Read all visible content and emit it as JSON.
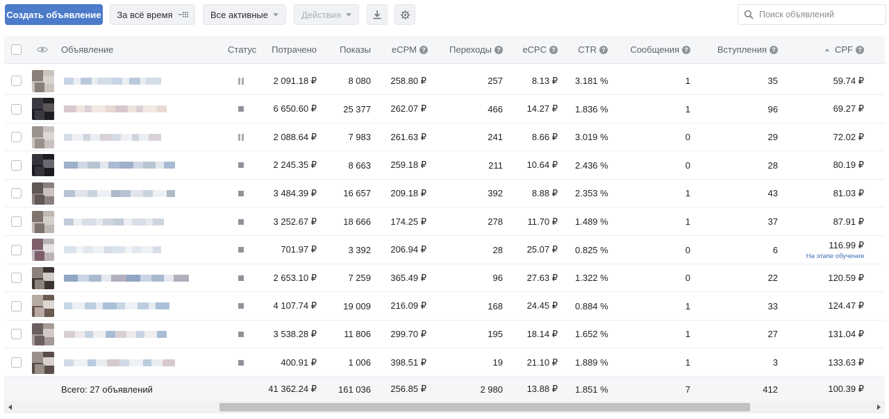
{
  "toolbar": {
    "create_label": "Создать объявление",
    "period_label": "За всё время",
    "filter_label": "Все активные",
    "actions_label": "Действия",
    "search_placeholder": "Поиск объявлений"
  },
  "columns": {
    "ad": "Объявление",
    "status": "Статус",
    "spent": "Потрачено",
    "impressions": "Показы",
    "ecpm": "eCPM",
    "clicks": "Переходы",
    "ecpc": "eCPC",
    "ctr": "CTR",
    "messages": "Сообщения",
    "joins": "Вступления",
    "cpf": "CPF"
  },
  "rows": [
    {
      "status": "paused",
      "spent": "2 091.18 ₽",
      "impressions": "8 080",
      "ecpm": "258.80 ₽",
      "clicks": "257",
      "ecpc": "8.13 ₽",
      "ctr": "3.181 %",
      "messages": "1",
      "joins": "35",
      "cpf": "59.74 ₽",
      "cpf_note": ""
    },
    {
      "status": "stopped",
      "spent": "6 650.60 ₽",
      "impressions": "25 377",
      "ecpm": "262.07 ₽",
      "clicks": "466",
      "ecpc": "14.27 ₽",
      "ctr": "1.836 %",
      "messages": "1",
      "joins": "96",
      "cpf": "69.27 ₽",
      "cpf_note": ""
    },
    {
      "status": "paused",
      "spent": "2 088.64 ₽",
      "impressions": "7 983",
      "ecpm": "261.63 ₽",
      "clicks": "241",
      "ecpc": "8.66 ₽",
      "ctr": "3.019 %",
      "messages": "0",
      "joins": "29",
      "cpf": "72.02 ₽",
      "cpf_note": ""
    },
    {
      "status": "stopped",
      "spent": "2 245.35 ₽",
      "impressions": "8 663",
      "ecpm": "259.18 ₽",
      "clicks": "211",
      "ecpc": "10.64 ₽",
      "ctr": "2.436 %",
      "messages": "0",
      "joins": "28",
      "cpf": "80.19 ₽",
      "cpf_note": ""
    },
    {
      "status": "stopped",
      "spent": "3 484.39 ₽",
      "impressions": "16 657",
      "ecpm": "209.18 ₽",
      "clicks": "392",
      "ecpc": "8.88 ₽",
      "ctr": "2.353 %",
      "messages": "1",
      "joins": "43",
      "cpf": "81.03 ₽",
      "cpf_note": ""
    },
    {
      "status": "stopped",
      "spent": "3 252.67 ₽",
      "impressions": "18 666",
      "ecpm": "174.25 ₽",
      "clicks": "278",
      "ecpc": "11.70 ₽",
      "ctr": "1.489 %",
      "messages": "1",
      "joins": "37",
      "cpf": "87.91 ₽",
      "cpf_note": ""
    },
    {
      "status": "stopped",
      "spent": "701.97 ₽",
      "impressions": "3 392",
      "ecpm": "206.94 ₽",
      "clicks": "28",
      "ecpc": "25.07 ₽",
      "ctr": "0.825 %",
      "messages": "0",
      "joins": "6",
      "cpf": "116.99 ₽",
      "cpf_note": "На этапе обучения"
    },
    {
      "status": "stopped",
      "spent": "2 653.10 ₽",
      "impressions": "7 259",
      "ecpm": "365.49 ₽",
      "clicks": "96",
      "ecpc": "27.63 ₽",
      "ctr": "1.322 %",
      "messages": "0",
      "joins": "22",
      "cpf": "120.59 ₽",
      "cpf_note": ""
    },
    {
      "status": "stopped",
      "spent": "4 107.74 ₽",
      "impressions": "19 009",
      "ecpm": "216.09 ₽",
      "clicks": "168",
      "ecpc": "24.45 ₽",
      "ctr": "0.884 %",
      "messages": "1",
      "joins": "33",
      "cpf": "124.47 ₽",
      "cpf_note": ""
    },
    {
      "status": "stopped",
      "spent": "3 538.28 ₽",
      "impressions": "11 806",
      "ecpm": "299.70 ₽",
      "clicks": "195",
      "ecpc": "18.14 ₽",
      "ctr": "1.652 %",
      "messages": "1",
      "joins": "27",
      "cpf": "131.04 ₽",
      "cpf_note": ""
    },
    {
      "status": "stopped",
      "spent": "400.91 ₽",
      "impressions": "1 006",
      "ecpm": "398.51 ₽",
      "clicks": "19",
      "ecpc": "21.10 ₽",
      "ctr": "1.889 %",
      "messages": "1",
      "joins": "3",
      "cpf": "133.63 ₽",
      "cpf_note": ""
    }
  ],
  "totals": {
    "label": "Всего: 27 объявлений",
    "spent": "41 362.24 ₽",
    "impressions": "161 036",
    "ecpm": "256.85 ₽",
    "clicks": "2 980",
    "ecpc": "13.88 ₽",
    "ctr": "1.851 %",
    "messages": "7",
    "joins": "412",
    "cpf": "100.39 ₽"
  },
  "colors": {
    "accent": "#4b7bc9",
    "header_bg": "#f5f6f8",
    "link": "#3d6fb7"
  },
  "icons": {
    "period": "grid-icon",
    "download": "download-icon",
    "settings": "gear-icon",
    "search": "search-icon",
    "visibility": "eye-icon",
    "help": "help-icon",
    "sort": "sort-asc-icon"
  }
}
